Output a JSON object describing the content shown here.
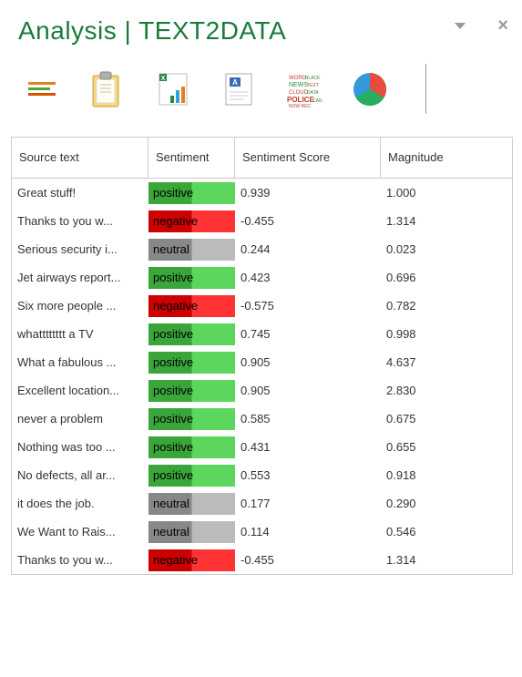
{
  "header": {
    "title": "Analysis | TEXT2DATA"
  },
  "table": {
    "columns": {
      "source": "Source text",
      "sentiment": "Sentiment",
      "score": "Sentiment Score",
      "magnitude": "Magnitude"
    },
    "rows": [
      {
        "source": "Great stuff!",
        "sentiment": "positive",
        "score": "0.939",
        "magnitude": "1.000"
      },
      {
        "source": "Thanks to you w...",
        "sentiment": "negative",
        "score": "-0.455",
        "magnitude": "1.314"
      },
      {
        "source": "Serious security i...",
        "sentiment": "neutral",
        "score": "0.244",
        "magnitude": "0.023"
      },
      {
        "source": "Jet airways report...",
        "sentiment": "positive",
        "score": "0.423",
        "magnitude": "0.696"
      },
      {
        "source": "Six more people ...",
        "sentiment": "negative",
        "score": "-0.575",
        "magnitude": "0.782"
      },
      {
        "source": "whatttttttt a TV",
        "sentiment": "positive",
        "score": "0.745",
        "magnitude": "0.998"
      },
      {
        "source": "What a fabulous ...",
        "sentiment": "positive",
        "score": "0.905",
        "magnitude": "4.637"
      },
      {
        "source": "Excellent location...",
        "sentiment": "positive",
        "score": "0.905",
        "magnitude": "2.830"
      },
      {
        "source": "never a problem",
        "sentiment": "positive",
        "score": "0.585",
        "magnitude": "0.675"
      },
      {
        "source": "Nothing was too ...",
        "sentiment": "positive",
        "score": "0.431",
        "magnitude": "0.655"
      },
      {
        "source": "No defects, all ar...",
        "sentiment": "positive",
        "score": "0.553",
        "magnitude": "0.918"
      },
      {
        "source": "it does the job.",
        "sentiment": "neutral",
        "score": "0.177",
        "magnitude": "0.290"
      },
      {
        "source": "We Want to Rais...",
        "sentiment": "neutral",
        "score": "0.114",
        "magnitude": "0.546"
      },
      {
        "source": "Thanks to you w...",
        "sentiment": "negative",
        "score": "-0.455",
        "magnitude": "1.314"
      }
    ]
  }
}
